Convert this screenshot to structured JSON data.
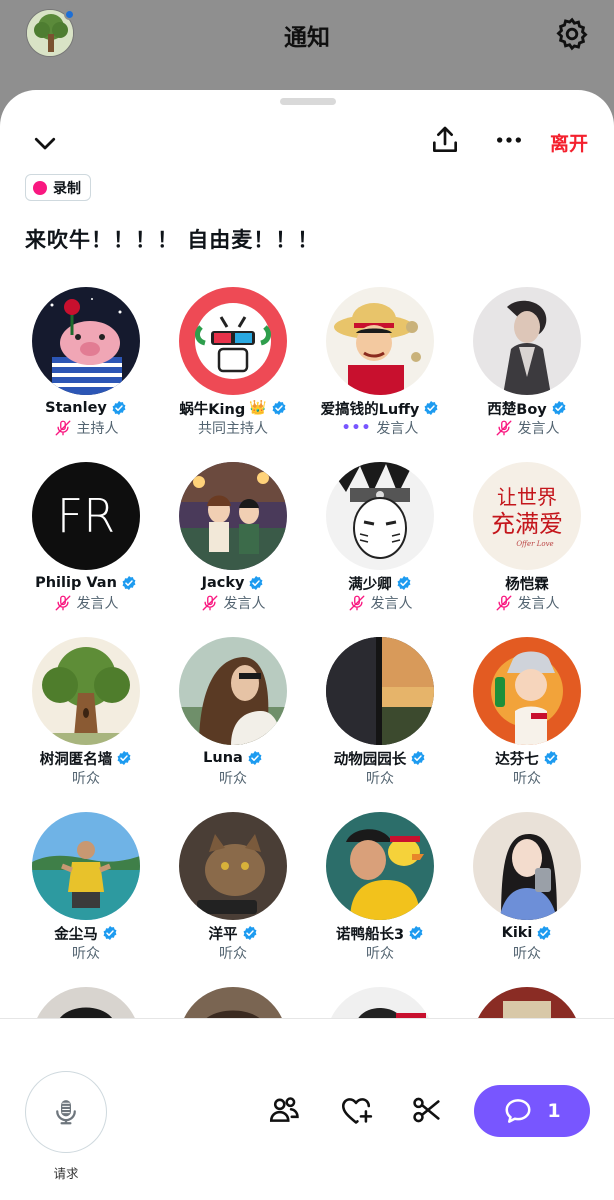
{
  "header": {
    "title": "通知"
  },
  "space": {
    "leave_label": "离开",
    "recording_label": "录制",
    "title": "来吹牛！！！！ 自由麦！！！"
  },
  "participants": [
    {
      "name": "Stanley",
      "role": "主持人",
      "mic": "muted",
      "verified": true
    },
    {
      "name": "蜗牛King",
      "role": "共同主持人",
      "mic": "none",
      "verified": true,
      "badge": "👑"
    },
    {
      "name": "爱搞钱的Luffy",
      "role": "发言人",
      "mic": "speaking",
      "verified": true
    },
    {
      "name": "西楚Boy",
      "role": "发言人",
      "mic": "muted",
      "verified": true
    },
    {
      "name": "Philip Van",
      "role": "发言人",
      "mic": "muted",
      "verified": true
    },
    {
      "name": "Jacky",
      "role": "发言人",
      "mic": "muted",
      "verified": true
    },
    {
      "name": "满少卿",
      "role": "发言人",
      "mic": "muted",
      "verified": true
    },
    {
      "name": "杨恺霖",
      "role": "发言人",
      "mic": "muted",
      "verified": false
    },
    {
      "name": "树洞匿名墙",
      "role": "听众",
      "mic": "none",
      "verified": true
    },
    {
      "name": "Luna",
      "role": "听众",
      "mic": "none",
      "verified": true
    },
    {
      "name": "动物园园长",
      "role": "听众",
      "mic": "none",
      "verified": true
    },
    {
      "name": "达芬七",
      "role": "听众",
      "mic": "none",
      "verified": true
    },
    {
      "name": "金尘马",
      "role": "听众",
      "mic": "none",
      "verified": true
    },
    {
      "name": "洋平",
      "role": "听众",
      "mic": "none",
      "verified": true
    },
    {
      "name": "诺鸭船长3",
      "role": "听众",
      "mic": "none",
      "verified": true
    },
    {
      "name": "Kiki",
      "role": "听众",
      "mic": "none",
      "verified": true
    }
  ],
  "avatar_text": {
    "philip": "FR",
    "yang_line1": "让世界",
    "yang_line2": "充满爱",
    "yang_line3": "Offer Love"
  },
  "bottom": {
    "request_label": "请求",
    "comment_count": "1"
  },
  "colors": {
    "accent_purple": "#7856ff",
    "verified_blue": "#1d9bf0",
    "leave_red": "#f4212e",
    "mute_pink": "#f91880",
    "record_pink": "#f91880"
  }
}
